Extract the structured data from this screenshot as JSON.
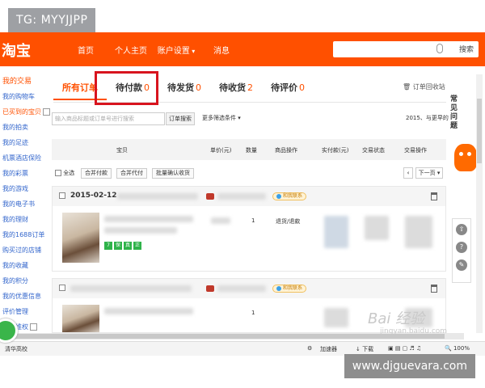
{
  "watermarks": {
    "tg": "TG: MYYJJPP",
    "site": "www.djguevara.com",
    "baidu": "Bai 经验",
    "baidu_sub": "jingyan.baidu.com"
  },
  "header": {
    "logo": "淘宝",
    "nav": [
      "首页",
      "个人主页",
      "账户设置",
      "消息"
    ],
    "search_button": "搜索",
    "accent_color": "#ff5000"
  },
  "sidebar": {
    "title": "我的交易",
    "items": [
      "我的购物车",
      "已买到的宝贝",
      "我的拍卖",
      "我的足迹",
      "机票酒店保险",
      "我的彩票",
      "我的游戏",
      "我的电子书",
      "我的理财",
      "我的1688订单",
      "购买过的店铺",
      "我的收藏",
      "我的积分",
      "我的优惠信息",
      "评价管理",
      "退款维权"
    ]
  },
  "tabs": [
    {
      "label": "所有订单",
      "count": ""
    },
    {
      "label": "待付款",
      "count": "0"
    },
    {
      "label": "待发货",
      "count": "0"
    },
    {
      "label": "待收货",
      "count": "2"
    },
    {
      "label": "待评价",
      "count": "0"
    }
  ],
  "recycle_link": "订单回收站",
  "order_search": {
    "placeholder": "输入商品标题或订单号进行搜索",
    "button": "订单搜索",
    "more_filter": "更多筛选条件",
    "year_link": "2015、与更早的"
  },
  "columns": [
    "宝贝",
    "单价(元)",
    "数量",
    "商品操作",
    "实付款(元)",
    "交易状态",
    "交易操作"
  ],
  "batch": {
    "select_all": "全选",
    "merge_pay": "合并付款",
    "merge_agent_pay": "合并代付",
    "batch_confirm": "批量确认收货",
    "prev": "‹",
    "next": "下一页"
  },
  "orders": [
    {
      "date": "2015-02-12",
      "ops": "退货/退款",
      "qty": "1",
      "wangwang": "和我联系",
      "tags": [
        "7",
        "保",
        "真",
        "正"
      ]
    },
    {
      "date": "",
      "ops": "",
      "qty": "1",
      "wangwang": "和我联系",
      "tags": []
    }
  ],
  "right_bar": {
    "faq": [
      "常",
      "见",
      "问",
      "题"
    ]
  },
  "statusbar": {
    "left": "清华高校",
    "accelerator": "加速器",
    "download": "下载",
    "zoom": "100%"
  }
}
